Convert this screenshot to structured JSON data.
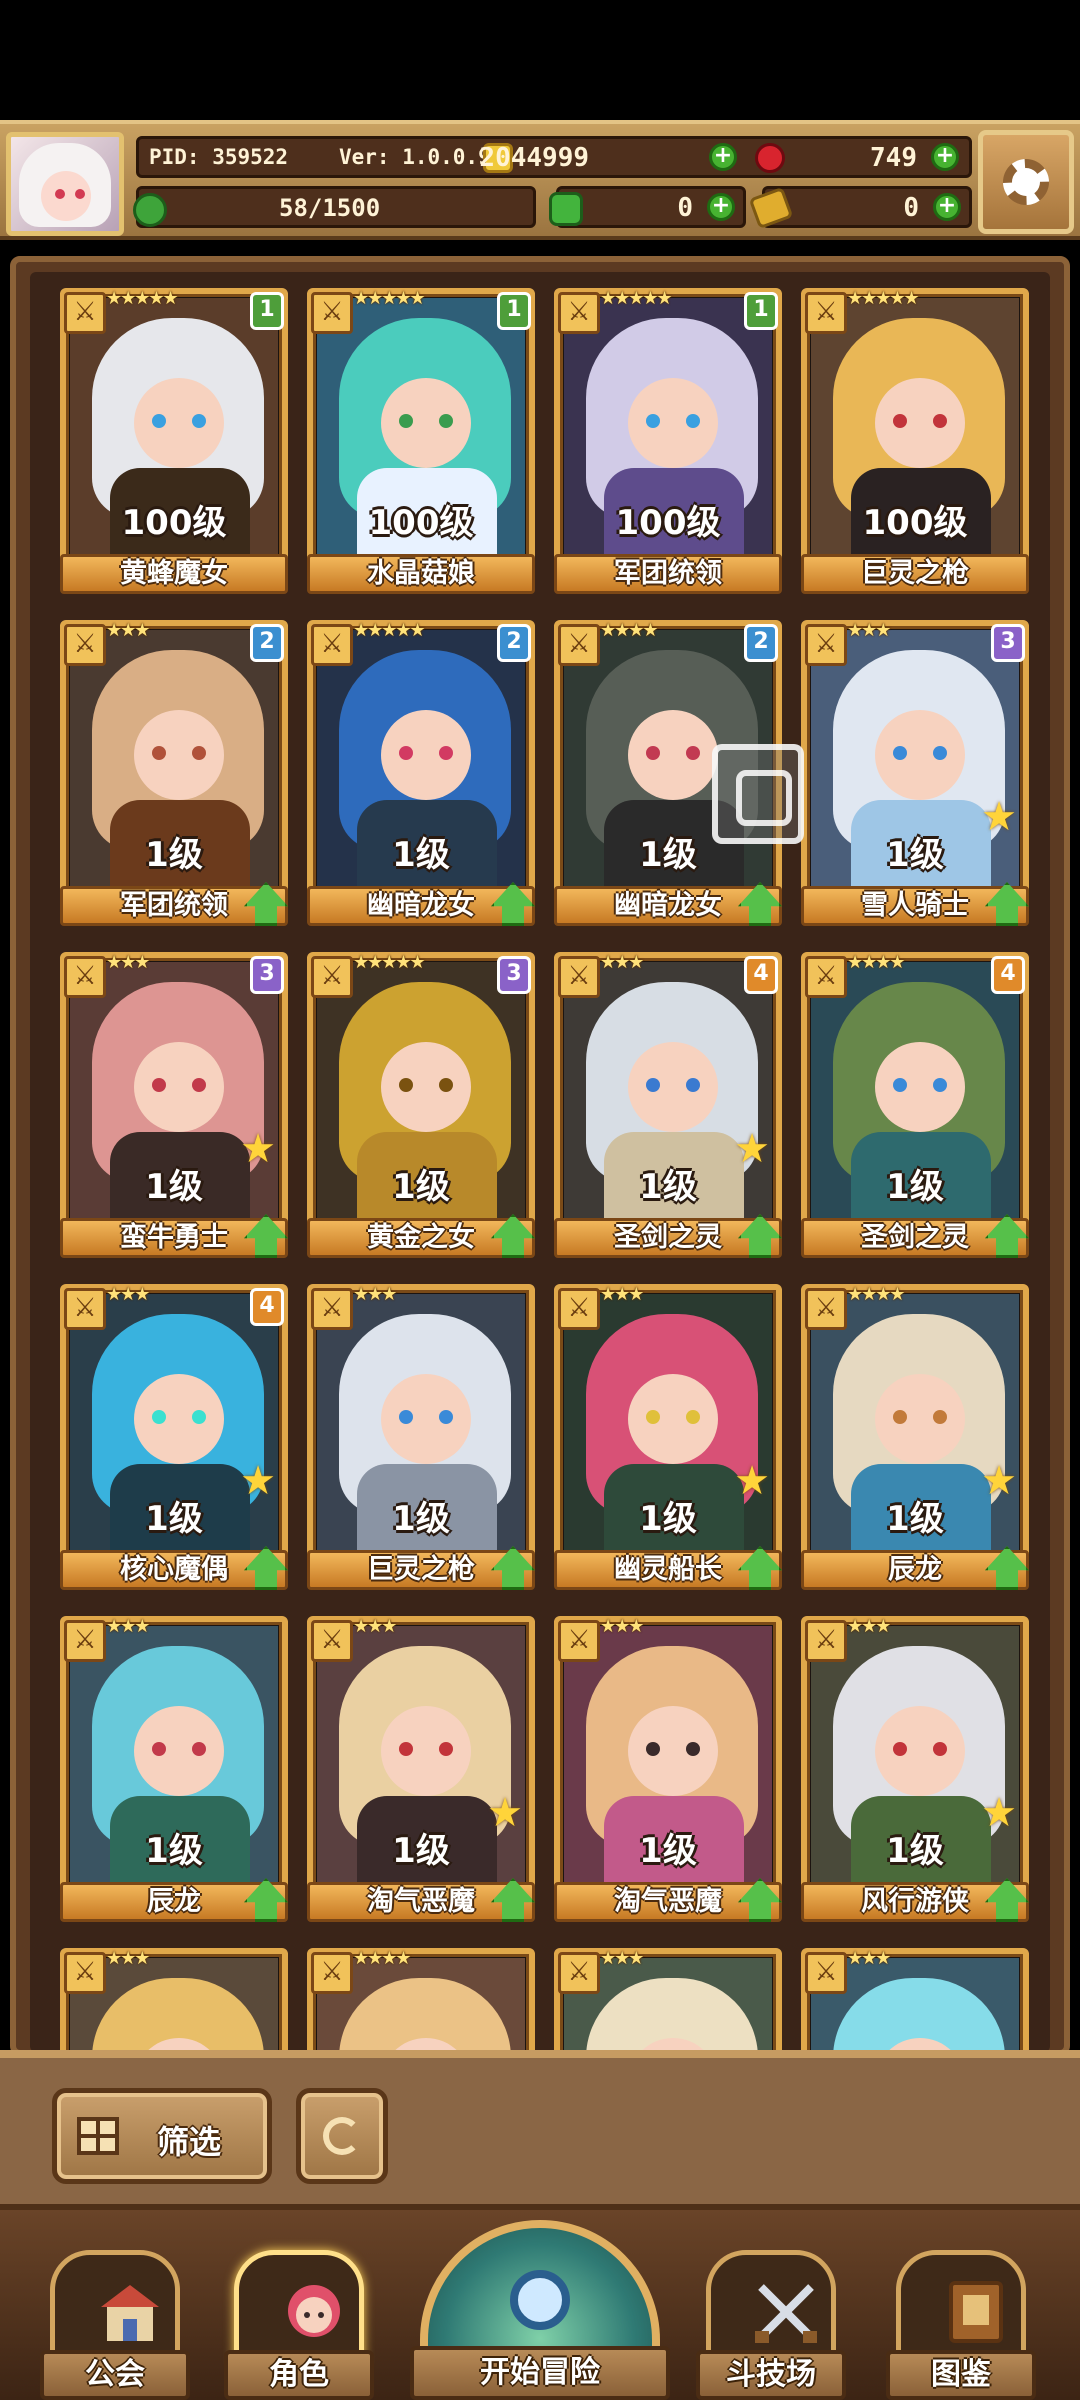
{
  "header": {
    "pid_label": "PID: 359522",
    "version_label": "Ver: 1.0.0.9",
    "gold": "2044999",
    "gems": "749",
    "exp": "58/1500",
    "clover": "0",
    "tickets": "0"
  },
  "roster": [
    {
      "name": "黄蜂魔女",
      "level": "100级",
      "stars": "★★★★★",
      "tier": "1",
      "tier_color": "#4e9e3a",
      "hair": "#eef0f6",
      "body": "#3b2a1a",
      "bg": "#5b3d2a",
      "eye": "#3aa0e0",
      "star_badge": false,
      "upgrade": false
    },
    {
      "name": "水晶菇娘",
      "level": "100级",
      "stars": "★★★★★",
      "tier": "1",
      "tier_color": "#4e9e3a",
      "hair": "#4dd2c1",
      "body": "#e8f2ff",
      "bg": "#2f5f78",
      "eye": "#3a9c4e",
      "star_badge": false,
      "upgrade": false
    },
    {
      "name": "军团统领",
      "level": "100级",
      "stars": "★★★★★",
      "tier": "1",
      "tier_color": "#4e9e3a",
      "hair": "#d9d4ef",
      "body": "#5e4c8c",
      "bg": "#3a3350",
      "eye": "#3aa0e0",
      "star_badge": false,
      "upgrade": false
    },
    {
      "name": "巨灵之枪",
      "level": "100级",
      "stars": "★★★★★",
      "tier": "",
      "tier_color": "",
      "hair": "#f0be58",
      "body": "#2a2222",
      "bg": "#5e4430",
      "eye": "#c2343a",
      "star_badge": false,
      "upgrade": false
    },
    {
      "name": "军团统领",
      "level": "1级",
      "stars": "★★★",
      "tier": "2",
      "tier_color": "#3b8fd0",
      "hair": "#e0b48a",
      "body": "#6b3a1c",
      "bg": "#4a3a30",
      "eye": "#b0523a",
      "star_badge": false,
      "upgrade": true
    },
    {
      "name": "幽暗龙女",
      "level": "1级",
      "stars": "★★★★★",
      "tier": "2",
      "tier_color": "#3b8fd0",
      "hair": "#2f6fc2",
      "body": "#263a4e",
      "bg": "#24324a",
      "eye": "#d23a62",
      "star_badge": false,
      "upgrade": true
    },
    {
      "name": "幽暗龙女",
      "level": "1级",
      "stars": "★★★★",
      "tier": "2",
      "tier_color": "#3b8fd0",
      "hair": "#5a6058",
      "body": "#2a2a2a",
      "bg": "#303a34",
      "eye": "#c23a52",
      "star_badge": false,
      "upgrade": true
    },
    {
      "name": "雪人骑士",
      "level": "1级",
      "stars": "★★★",
      "tier": "3",
      "tier_color": "#8a62c8",
      "hair": "#e8eef8",
      "body": "#9ec6e6",
      "bg": "#4a5e7a",
      "eye": "#3a8ad8",
      "star_badge": true,
      "upgrade": true
    },
    {
      "name": "蛮牛勇士",
      "level": "1级",
      "stars": "★★★",
      "tier": "3",
      "tier_color": "#8a62c8",
      "hair": "#e59a98",
      "body": "#3a2a26",
      "bg": "#5a3c36",
      "eye": "#c23a4a",
      "star_badge": true,
      "upgrade": true
    },
    {
      "name": "黄金之女",
      "level": "1级",
      "stars": "★★★★★",
      "tier": "3",
      "tier_color": "#8a62c8",
      "hair": "#d4a932",
      "body": "#b8892a",
      "bg": "#3e3224",
      "eye": "#7a5210",
      "star_badge": false,
      "upgrade": true
    },
    {
      "name": "圣剑之灵",
      "level": "1级",
      "stars": "★★★",
      "tier": "4",
      "tier_color": "#e08a2a",
      "hair": "#dfe6ee",
      "body": "#cfc0a0",
      "bg": "#3e3a36",
      "eye": "#3a7ad0",
      "star_badge": true,
      "upgrade": true
    },
    {
      "name": "圣剑之灵",
      "level": "1级",
      "stars": "★★★★",
      "tier": "4",
      "tier_color": "#e08a2a",
      "hair": "#6a8a4a",
      "body": "#2e6a6e",
      "bg": "#2a4a56",
      "eye": "#3a8ad8",
      "star_badge": false,
      "upgrade": true
    },
    {
      "name": "核心魔偶",
      "level": "1级",
      "stars": "★★★",
      "tier": "4",
      "tier_color": "#e08a2a",
      "hair": "#3ab8e6",
      "body": "#1e3c4a",
      "bg": "#2a3e4a",
      "eye": "#3ae0d0",
      "star_badge": true,
      "upgrade": true
    },
    {
      "name": "巨灵之枪",
      "level": "1级",
      "stars": "★★★",
      "tier": "",
      "tier_color": "",
      "hair": "#e6ecf4",
      "body": "#8a94a4",
      "bg": "#3a4452",
      "eye": "#3a8ad8",
      "star_badge": false,
      "upgrade": true
    },
    {
      "name": "幽灵船长",
      "level": "1级",
      "stars": "★★★",
      "tier": "",
      "tier_color": "",
      "hair": "#e2527a",
      "body": "#2e4a3a",
      "bg": "#2a3a30",
      "eye": "#e0c03a",
      "star_badge": true,
      "upgrade": true
    },
    {
      "name": "辰龙",
      "level": "1级",
      "stars": "★★★★",
      "tier": "",
      "tier_color": "",
      "hair": "#efe0c6",
      "body": "#3a88b0",
      "bg": "#3a5060",
      "eye": "#c27a3a",
      "star_badge": true,
      "upgrade": true
    },
    {
      "name": "辰龙",
      "level": "1级",
      "stars": "★★★",
      "tier": "",
      "tier_color": "",
      "hair": "#6ad0e0",
      "body": "#2e6a5a",
      "bg": "#3a5462",
      "eye": "#c23a4a",
      "star_badge": false,
      "upgrade": true
    },
    {
      "name": "淘气恶魔",
      "level": "1级",
      "stars": "★★★",
      "tier": "",
      "tier_color": "",
      "hair": "#f2d8a8",
      "body": "#3a2a2a",
      "bg": "#5a4040",
      "eye": "#c2343a",
      "star_badge": true,
      "upgrade": true
    },
    {
      "name": "淘气恶魔",
      "level": "1级",
      "stars": "★★★",
      "tier": "",
      "tier_color": "",
      "hair": "#f0c08a",
      "body": "#c25a8a",
      "bg": "#6a3a4a",
      "eye": "#3a2a2a",
      "star_badge": false,
      "upgrade": true
    },
    {
      "name": "风行游侠",
      "level": "1级",
      "stars": "★★★",
      "tier": "",
      "tier_color": "",
      "hair": "#e8e8ee",
      "body": "#4a6a3a",
      "bg": "#4a4a3a",
      "eye": "#c2343a",
      "star_badge": true,
      "upgrade": true
    },
    {
      "name": "",
      "level": "",
      "stars": "★★★",
      "tier": "",
      "tier_color": "",
      "hair": "#f0c46a",
      "body": "#a8322a",
      "bg": "#5a4a3a",
      "eye": "#3a2a2a",
      "star_badge": false,
      "upgrade": false
    },
    {
      "name": "",
      "level": "",
      "stars": "★★★★",
      "tier": "",
      "tier_color": "",
      "hair": "#f2c88a",
      "body": "#c26a4a",
      "bg": "#6a4a3a",
      "eye": "#3a2a2a",
      "star_badge": false,
      "upgrade": false
    },
    {
      "name": "",
      "level": "",
      "stars": "★★★",
      "tier": "",
      "tier_color": "",
      "hair": "#f6e8c8",
      "body": "#8ad0a0",
      "bg": "#4a5a4a",
      "eye": "#3a2a2a",
      "star_badge": false,
      "upgrade": false
    },
    {
      "name": "",
      "level": "",
      "stars": "★★★",
      "tier": "",
      "tier_color": "",
      "hair": "#8ae4f0",
      "body": "#3a8ab0",
      "bg": "#3a5a6a",
      "eye": "#3a2a2a",
      "star_badge": false,
      "upgrade": false
    }
  ],
  "controls": {
    "filter_label": "筛选"
  },
  "nav": {
    "guild": "公会",
    "character": "角色",
    "adventure": "开始冒险",
    "arena": "斗技场",
    "codex": "图鉴"
  }
}
